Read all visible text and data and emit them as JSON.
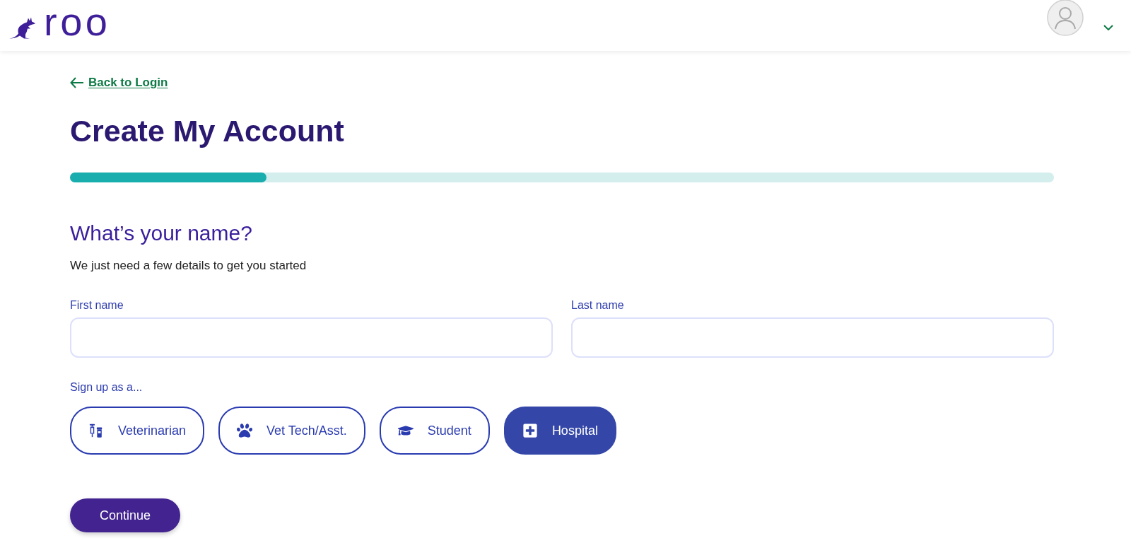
{
  "header": {
    "logo_text": "roo"
  },
  "back_link": {
    "label": "Back to Login"
  },
  "title": "Create My Account",
  "progress": {
    "level": 0.2
  },
  "section": {
    "heading": "What’s your name?",
    "subtitle": "We just need a few details to get you started"
  },
  "fields": [
    {
      "label": "First name"
    },
    {
      "label": "Last name"
    }
  ],
  "role_prompt": "Sign up as a...",
  "roles": [
    {
      "label": "Veterinarian",
      "selected": false
    },
    {
      "label": "Vet Tech/Asst.",
      "selected": false
    },
    {
      "label": "Student",
      "selected": false
    },
    {
      "label": "Hospital",
      "selected": true
    }
  ],
  "continue_button": {
    "label": "Continue"
  }
}
